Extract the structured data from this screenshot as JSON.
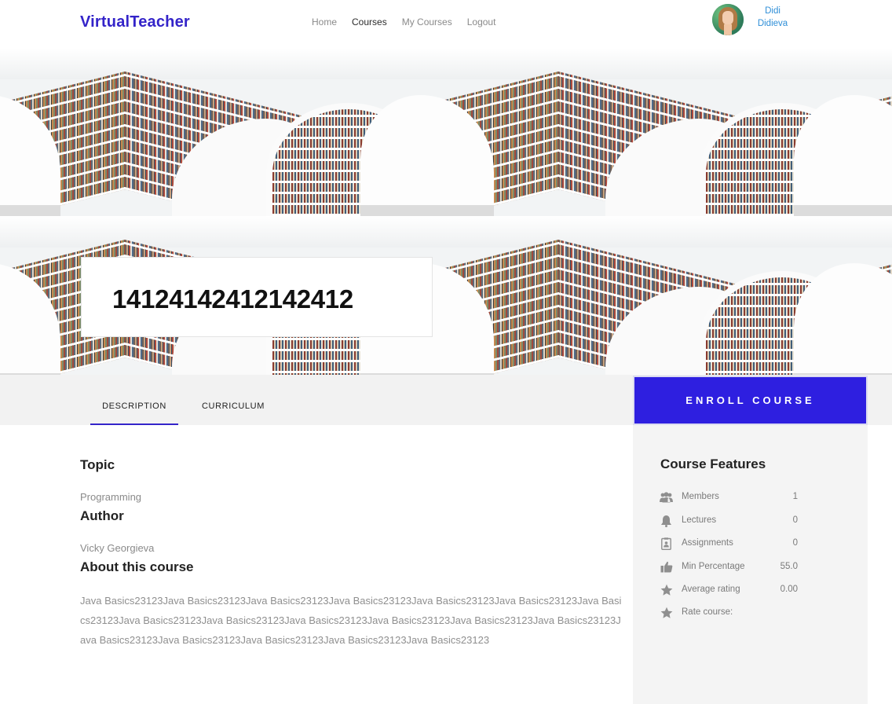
{
  "header": {
    "logo": "VirtualTeacher",
    "nav": [
      {
        "label": "Home",
        "active": false
      },
      {
        "label": "Courses",
        "active": true
      },
      {
        "label": "My Courses",
        "active": false
      },
      {
        "label": "Logout",
        "active": false
      }
    ],
    "user": {
      "first_name": "Didi",
      "last_name": "Didieva"
    }
  },
  "hero": {
    "course_title": "14124142412142412"
  },
  "tabs": [
    {
      "label": "DESCRIPTION",
      "active": true
    },
    {
      "label": "CURRICULUM",
      "active": false
    }
  ],
  "enroll_label": "ENROLL COURSE",
  "main": {
    "topic_heading": "Topic",
    "topic_value": "Programming",
    "author_heading": "Author",
    "author_value": "Vicky Georgieva",
    "about_heading": "About this course",
    "about_text": "Java Basics23123Java Basics23123Java Basics23123Java Basics23123Java Basics23123Java Basics23123Java Basics23123Java Basics23123Java Basics23123Java Basics23123Java Basics23123Java Basics23123Java Basics23123Java Basics23123Java Basics23123Java Basics23123Java Basics23123Java Basics23123"
  },
  "features": {
    "title": "Course Features",
    "items": [
      {
        "icon": "members-icon",
        "label": "Members",
        "value": "1"
      },
      {
        "icon": "lectures-icon",
        "label": "Lectures",
        "value": "0"
      },
      {
        "icon": "assignments-icon",
        "label": "Assignments",
        "value": "0"
      },
      {
        "icon": "thumbs-up-icon",
        "label": "Min Percentage",
        "value": "55.0"
      },
      {
        "icon": "star-icon",
        "label": "Average rating",
        "value": "0.00"
      },
      {
        "icon": "star-icon",
        "label": "Rate course:",
        "value": ""
      }
    ]
  },
  "colors": {
    "brand": "#3424c9",
    "enroll": "#2e1fe0",
    "user_link": "#2f8fd8"
  }
}
